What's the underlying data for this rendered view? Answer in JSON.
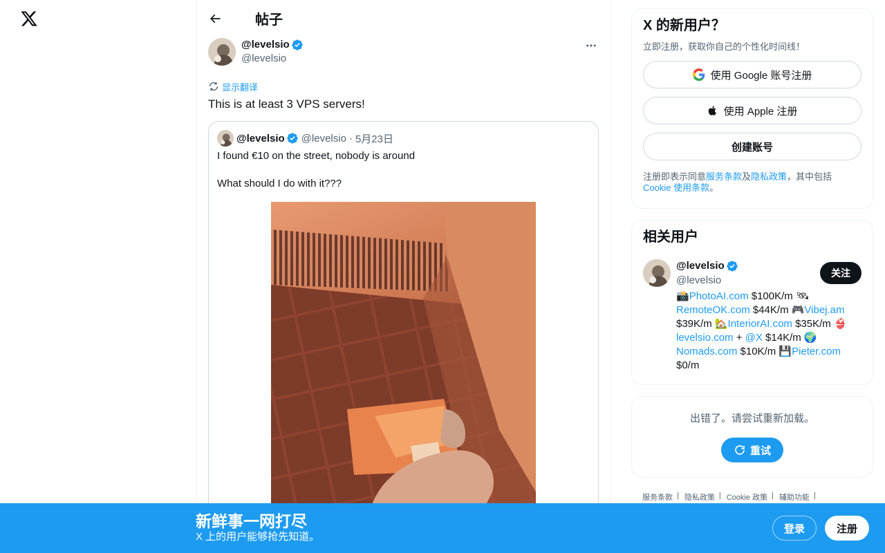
{
  "header": {
    "title": "帖子"
  },
  "post": {
    "display_name": "@levelsio",
    "handle": "@levelsio",
    "translate_label": "显示翻译",
    "text": "This is at least 3 VPS servers!",
    "quote": {
      "display_name": "@levelsio",
      "handle": "@levelsio",
      "separator": "·",
      "date": "5月23日",
      "line1": "I found €10 on the street, nobody is around",
      "line2": "What should I do with it???"
    }
  },
  "signup_card": {
    "title": "X 的新用户？",
    "subtitle": "立即注册，获取你自己的个性化时间线！",
    "google_label": "使用 Google 账号注册",
    "apple_label": "使用 Apple 注册",
    "create_label": "创建账号",
    "legal_prefix": "注册即表示同意",
    "terms_link": "服务条款",
    "and": "及",
    "privacy_link": "隐私政策",
    "legal_middle": "，其中包括 ",
    "cookie_link": "Cookie 使用条款",
    "legal_suffix": "。"
  },
  "related": {
    "title": "相关用户",
    "display_name": "@levelsio",
    "handle": "@levelsio",
    "follow_label": "关注",
    "bio": {
      "e1": "📸",
      "l1": "PhotoAI.com",
      "t1": " $100K/m 🛰 ",
      "l2": "RemoteOK.com",
      "t2": " $44K/m 🎮",
      "l3": "Vibej.am",
      "t3": " $39K/m 🏡",
      "l4": "InteriorAI.com",
      "t4": " $35K/m 👙 ",
      "l5": "levelsio.com",
      "t5": " + ",
      "l6": "@X",
      "t6": " $14K/m 🌍 ",
      "l7": "Nomads.com",
      "t7": " $10K/m 💾",
      "l8": "Pieter.com",
      "t8": " $0/m"
    }
  },
  "error_card": {
    "text": "出错了。请尝试重新加载。",
    "retry_label": "重试"
  },
  "footer": {
    "terms": "服务条款",
    "privacy": "隐私政策",
    "cookie": "Cookie 政策",
    "accessibility": "辅助功能",
    "sep": "|"
  },
  "bottom_bar": {
    "title": "新鲜事一网打尽",
    "subtitle": "X 上的用户能够抢先知道。",
    "login_label": "登录",
    "signup_label": "注册"
  },
  "colors": {
    "accent": "#1d9bf0",
    "text": "#0f1419",
    "muted": "#536471"
  },
  "icons": [
    "x-logo-icon",
    "back-arrow-icon",
    "verified-badge-icon",
    "more-icon",
    "translate-icon",
    "google-icon",
    "apple-icon",
    "refresh-icon"
  ]
}
